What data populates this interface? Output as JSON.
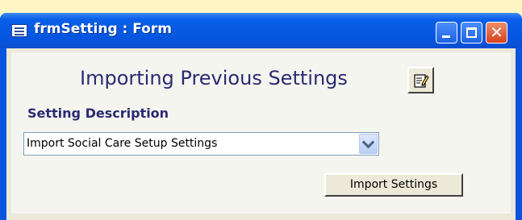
{
  "window": {
    "title": "frmSetting : Form",
    "icons": {
      "app": "form-icon",
      "minimize": "minimize-icon",
      "maximize": "maximize-icon",
      "close": "close-icon"
    }
  },
  "form": {
    "heading": "Importing Previous Settings",
    "edit_icon": "edit-notepad-icon",
    "description_label": "Setting Description",
    "description_value": "Import Social Care Setup Settings",
    "dropdown_icon": "chevron-down-icon",
    "import_button": "Import Settings"
  },
  "colors": {
    "titlebar": "#0456e0",
    "heading_text": "#2b2a73",
    "close_button": "#d6401b",
    "background": "#fdf6c3"
  }
}
